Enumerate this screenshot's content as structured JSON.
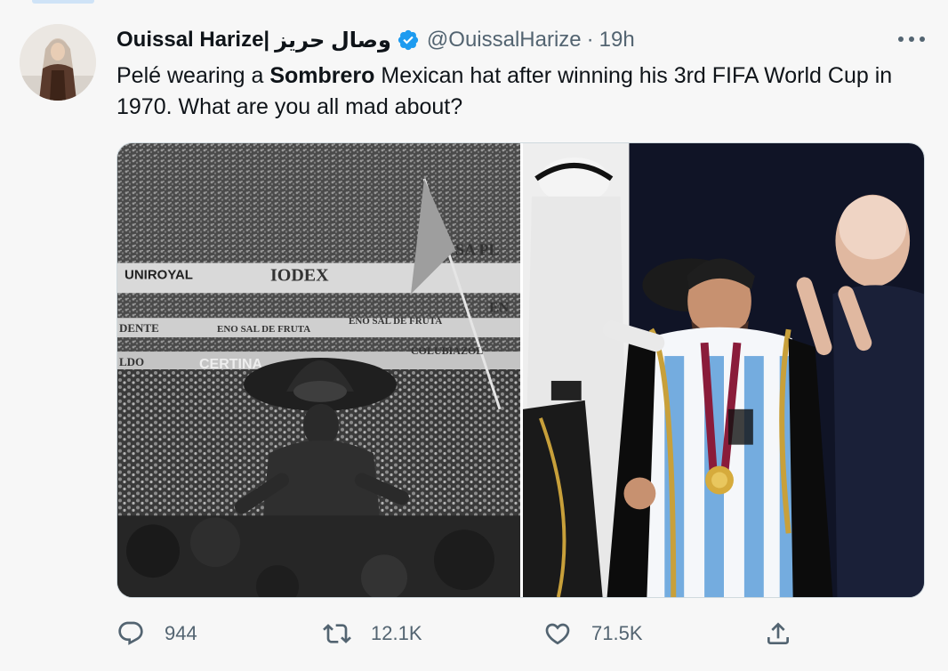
{
  "author": {
    "display_name": "Ouissal Harize|",
    "display_name_arabic": "وصال حريز",
    "handle": "@OuissalHarize",
    "separator": "·",
    "time": "19h",
    "verified": true
  },
  "tweet": {
    "text_before": "Pelé wearing a ",
    "text_bold": "Sombrero",
    "text_after": " Mexican hat after winning his 3rd FIFA World Cup in 1970. What are you all mad about?"
  },
  "media": {
    "left_photo_signs": {
      "uniroyal": "UNIROYAL",
      "iodex": "IODEX",
      "sa_pl": "SA PL",
      "dente": "DENTE",
      "eno_1": "ENO SAL DE FRUTA",
      "eno_2": "ENO SAL DE FRUTA",
      "en": "EN",
      "ldo": "LDO",
      "certina": "CERTINA",
      "colubiazol": "COLUBIAZOL"
    }
  },
  "actions": {
    "replies": "944",
    "retweets": "12.1K",
    "likes": "71.5K"
  },
  "colors": {
    "text_primary": "#0f1419",
    "text_secondary": "#536471",
    "verified_blue": "#1d9bf0",
    "border": "#cfd9de",
    "background": "#f7f7f7"
  },
  "icons": {
    "verified": "verified-badge-icon",
    "more": "more-icon",
    "reply": "reply-icon",
    "retweet": "retweet-icon",
    "like": "like-icon",
    "share": "share-icon"
  }
}
